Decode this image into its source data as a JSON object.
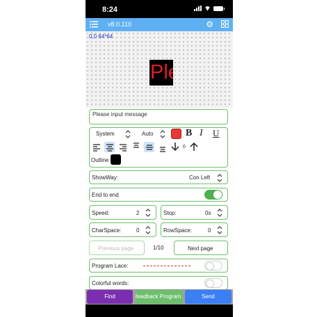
{
  "status": {
    "time": "8:24"
  },
  "appbar": {
    "version": "v8.0.110"
  },
  "preview": {
    "coords": "0,0 64*64",
    "led_text": "Ple"
  },
  "message": {
    "placeholder": "Please input message"
  },
  "format": {
    "font": "System",
    "size": "Auto",
    "bold": "B",
    "italic": "I",
    "underline": "U",
    "spacing_value": "0",
    "outline_label": "Outline",
    "text_color": "#e53935",
    "outline_color": "#000000"
  },
  "showway": {
    "label": "ShowWay:",
    "value": "Con Left"
  },
  "end_to_end": {
    "label": "End to end",
    "on": true
  },
  "speed": {
    "label": "Speed:",
    "value": "2"
  },
  "stop": {
    "label": "Stop:",
    "value": "0s"
  },
  "charspace": {
    "label": "CharSpace:",
    "value": "0"
  },
  "rowspace": {
    "label": "RowSpace:",
    "value": "0"
  },
  "pager": {
    "prev": "Previous page",
    "page": "1/10",
    "next": "Next page"
  },
  "lace": {
    "label": "Program Lace:",
    "on": false
  },
  "colorful": {
    "label": "Colorful words:",
    "on": false
  },
  "actions": {
    "find": "Find",
    "readback": "Readback Program",
    "send": "Send"
  },
  "colors": {
    "accent": "#5eb0f3",
    "find": "#7b2fb0",
    "readback": "#6cbf6c",
    "send": "#3b7ff5",
    "border": "#6cbf6c"
  }
}
